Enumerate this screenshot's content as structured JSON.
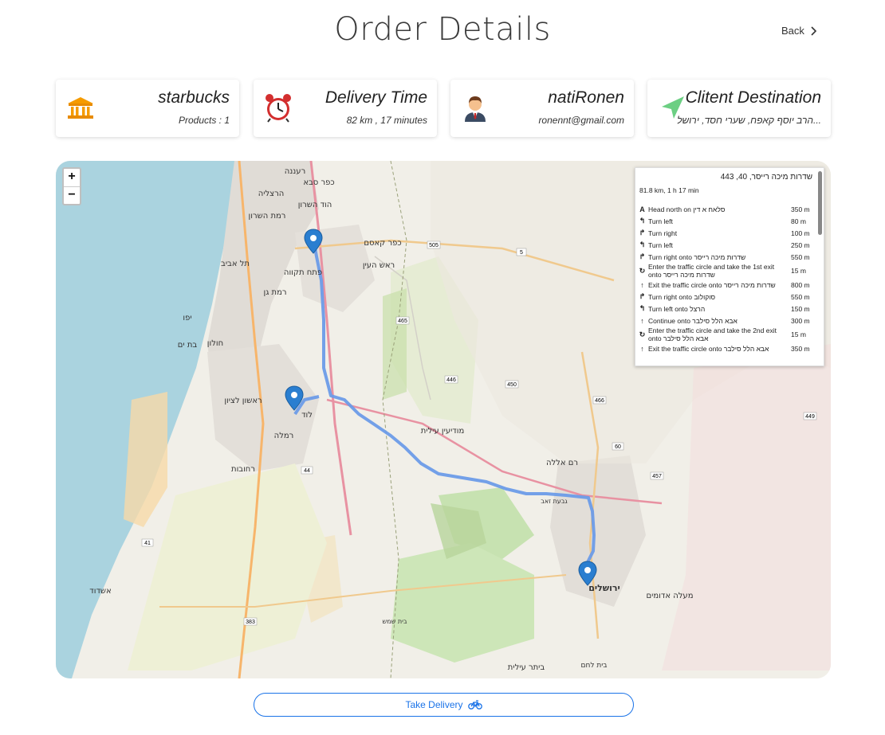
{
  "page_title": "Order Details",
  "back_label": "Back",
  "cards": {
    "store": {
      "title": "starbucks",
      "subtitle": "Products : 1",
      "icon": "bank-icon"
    },
    "delivery_time": {
      "title": "Delivery Time",
      "subtitle": "82 km , 17 minutes",
      "icon": "alarm-clock-icon"
    },
    "customer": {
      "title": "natiRonen",
      "subtitle": "ronennt@gmail.com",
      "icon": "person-icon"
    },
    "destination": {
      "title": "Clitent Destination",
      "subtitle": "הרב יוסף קאפח, שערי חסד, ירושל...",
      "icon": "navigation-arrow-icon"
    }
  },
  "map": {
    "zoom_in": "+",
    "zoom_out": "−",
    "labels": [
      "רעננה",
      "כפר סבא",
      "הרצליה",
      "הוד השרון",
      "רמת השרון",
      "פתח תקווה",
      "ראש העין",
      "כפר קאסם",
      "תל אביב",
      "רמת גן",
      "יפו",
      "בת ים",
      "חולון",
      "ראשון לציון",
      "רחובות",
      "לוד",
      "רמלה",
      "מודיעין עילית",
      "רמאללה",
      "רם אללה",
      "ירושלים",
      "מעלה אדומים",
      "בית שמש",
      "אשדוד",
      "ביתר עילית",
      "בית לחם",
      "גבעת זאב",
      "505",
      "465",
      "446",
      "450",
      "466",
      "60",
      "457",
      "449",
      "44",
      "41",
      "383",
      "5"
    ],
    "route_panel": {
      "name": "שדרות מיכה רייסר, 40, 443",
      "summary": "81.8 km, 1 h 17 min",
      "steps": [
        {
          "icon": "A",
          "text": "Head north on סלאח א דין",
          "dist": "350 m"
        },
        {
          "icon": "↰",
          "text": "Turn left",
          "dist": "80 m"
        },
        {
          "icon": "↱",
          "text": "Turn right",
          "dist": "100 m"
        },
        {
          "icon": "↰",
          "text": "Turn left",
          "dist": "250 m"
        },
        {
          "icon": "↱",
          "text": "Turn right onto שדרות מיכה רייסר",
          "dist": "550 m"
        },
        {
          "icon": "↻",
          "text": "Enter the traffic circle and take the 1st exit onto שדרות מיכה רייסר",
          "dist": "15 m"
        },
        {
          "icon": "↑",
          "text": "Exit the traffic circle onto שדרות מיכה רייסר",
          "dist": "800 m"
        },
        {
          "icon": "↱",
          "text": "Turn right onto סוקולוב",
          "dist": "550 m"
        },
        {
          "icon": "↰",
          "text": "Turn left onto הרצל",
          "dist": "150 m"
        },
        {
          "icon": "↑",
          "text": "Continue onto אבא הלל סילבר",
          "dist": "300 m"
        },
        {
          "icon": "↻",
          "text": "Enter the traffic circle and take the 2nd exit onto אבא הלל סילבר",
          "dist": "15 m"
        },
        {
          "icon": "↑",
          "text": "Exit the traffic circle onto אבא הלל סילבר",
          "dist": "350 m"
        }
      ]
    }
  },
  "take_delivery_label": "Take Delivery",
  "colors": {
    "accent": "#1a73e8",
    "route": "#6b9be8",
    "marker": "#2a7ed0",
    "sea": "#aad3df",
    "land": "#f1efe8"
  }
}
